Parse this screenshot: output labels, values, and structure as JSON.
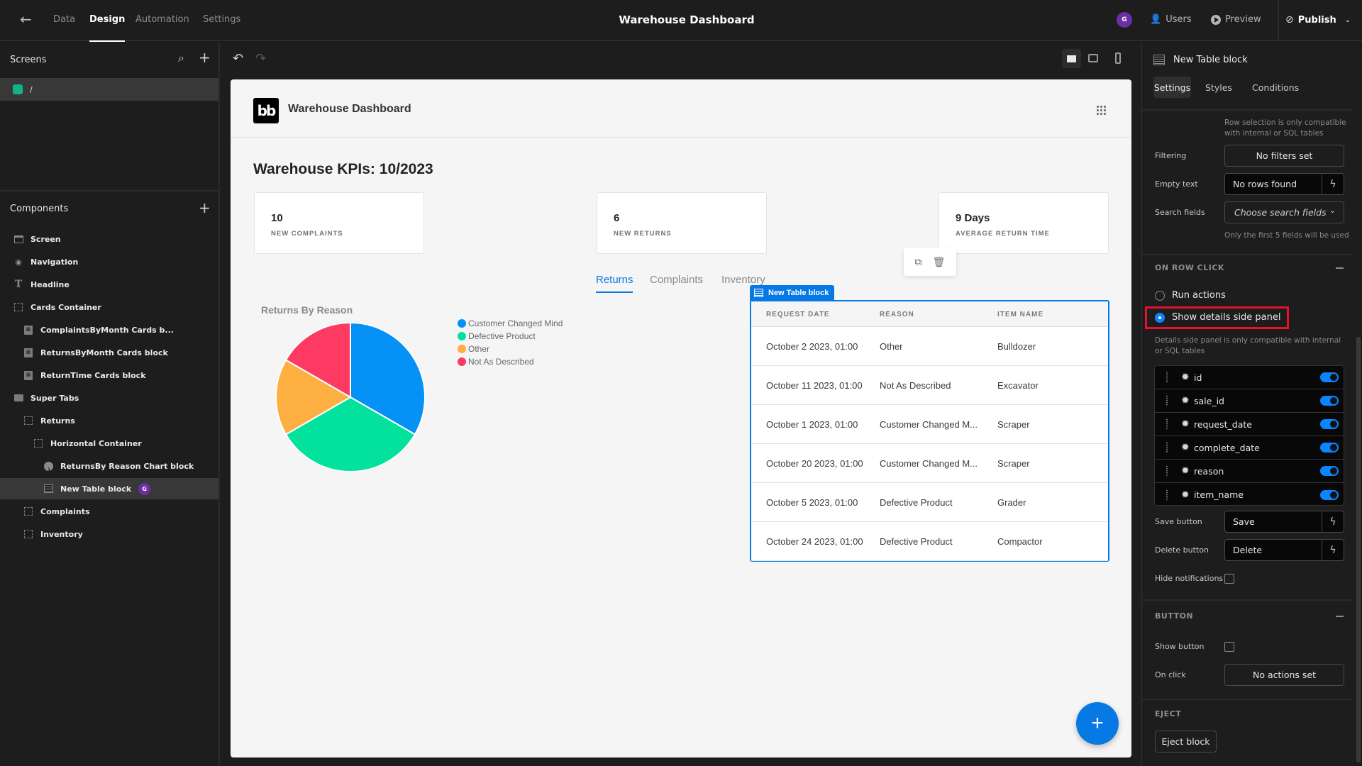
{
  "topbar": {
    "tabs": [
      {
        "label": "Data",
        "active": false
      },
      {
        "label": "Design",
        "active": true
      },
      {
        "label": "Automation",
        "active": false
      },
      {
        "label": "Settings",
        "active": false
      }
    ],
    "app_title": "Warehouse Dashboard",
    "avatar_initial": "G",
    "users_label": "Users",
    "preview_label": "Preview",
    "publish_label": "Publish"
  },
  "left_panel": {
    "screens_title": "Screens",
    "screens": [
      {
        "route": "/",
        "color": "#12b28a"
      }
    ],
    "components_title": "Components",
    "components": [
      {
        "label": "Screen",
        "icon": "screen-icon",
        "depth": 0
      },
      {
        "label": "Navigation",
        "icon": "eye-icon",
        "depth": 0
      },
      {
        "label": "Headline",
        "icon": "text-icon",
        "depth": 0
      },
      {
        "label": "Cards Container",
        "icon": "container-icon",
        "depth": 0
      },
      {
        "label": "ComplaintsByMonth Cards b...",
        "icon": "card-icon",
        "depth": 1
      },
      {
        "label": "ReturnsByMonth Cards block",
        "icon": "card-icon",
        "depth": 1
      },
      {
        "label": "ReturnTime Cards block",
        "icon": "card-icon",
        "depth": 1
      },
      {
        "label": "Super Tabs",
        "icon": "folder-icon",
        "depth": 0
      },
      {
        "label": "Returns",
        "icon": "container-icon",
        "depth": 1
      },
      {
        "label": "Horizontal Container",
        "icon": "container-icon",
        "depth": 2
      },
      {
        "label": "ReturnsBy Reason Chart block",
        "icon": "pie-chart-icon",
        "depth": 3
      },
      {
        "label": "New Table block",
        "icon": "table-icon",
        "depth": 3,
        "selected": true,
        "badge": "G"
      },
      {
        "label": "Complaints",
        "icon": "container-icon",
        "depth": 1
      },
      {
        "label": "Inventory",
        "icon": "container-icon",
        "depth": 1
      }
    ]
  },
  "canvas": {
    "logo_text": "bb",
    "app_name": "Warehouse Dashboard",
    "heading": "Warehouse KPIs: 10/2023",
    "kpis": [
      {
        "value": "10",
        "label": "NEW COMPLAINTS"
      },
      {
        "value": "6",
        "label": "NEW RETURNS"
      },
      {
        "value": "9 Days",
        "label": "AVERAGE RETURN TIME"
      }
    ],
    "tabs": [
      {
        "label": "Returns",
        "active": true
      },
      {
        "label": "Complaints",
        "active": false
      },
      {
        "label": "Inventory",
        "active": false
      }
    ],
    "table_block_label": "New Table block",
    "table": {
      "columns": [
        "REQUEST DATE",
        "REASON",
        "ITEM NAME"
      ],
      "rows": [
        [
          "October 2 2023, 01:00",
          "Other",
          "Bulldozer"
        ],
        [
          "October 11 2023, 01:00",
          "Not As Described",
          "Excavator"
        ],
        [
          "October 1 2023, 01:00",
          "Customer Changed M...",
          "Scraper"
        ],
        [
          "October 20 2023, 01:00",
          "Customer Changed M...",
          "Scraper"
        ],
        [
          "October 5 2023, 01:00",
          "Defective Product",
          "Grader"
        ],
        [
          "October 24 2023, 01:00",
          "Defective Product",
          "Compactor"
        ]
      ]
    },
    "fab_label": "+"
  },
  "chart_data": {
    "type": "pie",
    "title": "Returns By Reason",
    "categories": [
      "Customer Changed Mind",
      "Defective Product",
      "Other",
      "Not As Described"
    ],
    "values": [
      2,
      2,
      1,
      1
    ],
    "colors": [
      "#0591f5",
      "#03e29d",
      "#fdaf42",
      "#fd3b62"
    ],
    "legend": "top-right"
  },
  "right_panel": {
    "title": "New Table block",
    "tabs": [
      {
        "label": "Settings",
        "active": true
      },
      {
        "label": "Styles",
        "active": false
      },
      {
        "label": "Conditions",
        "active": false
      }
    ],
    "row_selection_hint": "Row selection is only compatible with internal or SQL tables",
    "filtering_label": "Filtering",
    "filtering_value": "No filters set",
    "empty_text_label": "Empty text",
    "empty_text_value": "No rows found",
    "search_fields_label": "Search fields",
    "search_fields_placeholder": "Choose search fields",
    "search_fields_hint": "Only the first 5 fields will be used",
    "on_row_click_title": "ON ROW CLICK",
    "radio_run_actions": "Run actions",
    "radio_show_details": "Show details side panel",
    "selected_option": "Show details side panel",
    "details_hint": "Details side panel is only compatible with internal or SQL tables",
    "fields": [
      {
        "name": "id",
        "enabled": true
      },
      {
        "name": "sale_id",
        "enabled": true
      },
      {
        "name": "request_date",
        "enabled": true
      },
      {
        "name": "complete_date",
        "enabled": true
      },
      {
        "name": "reason",
        "enabled": true
      },
      {
        "name": "item_name",
        "enabled": true
      }
    ],
    "save_button_label": "Save button",
    "save_button_value": "Save",
    "delete_button_label": "Delete button",
    "delete_button_value": "Delete",
    "hide_notifications_label": "Hide notifications",
    "hide_notifications_checked": false,
    "button_section_title": "BUTTON",
    "show_button_label": "Show button",
    "show_button_checked": false,
    "on_click_label": "On click",
    "on_click_value": "No actions set",
    "eject_section_title": "EJECT",
    "eject_button_label": "Eject block"
  },
  "highlight_color": "#e8102a"
}
